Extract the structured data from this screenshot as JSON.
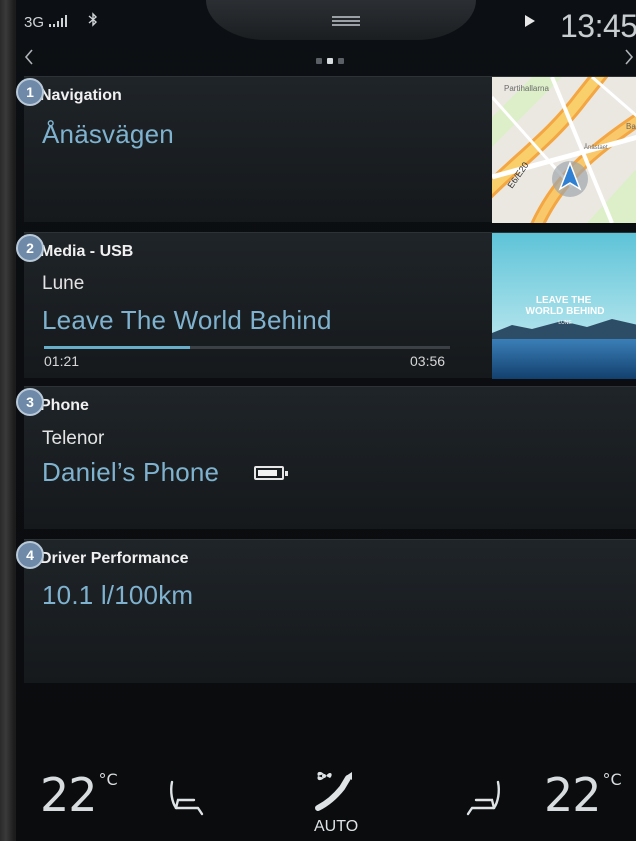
{
  "status_bar": {
    "network": "3G",
    "signal_icon": "signal-bars-icon",
    "bluetooth_icon": "bluetooth-icon",
    "play_icon": "play-icon",
    "clock": "13:45"
  },
  "pager": {
    "pages": 3,
    "active_index": 1
  },
  "badges": [
    "1",
    "2",
    "3",
    "4"
  ],
  "tiles": {
    "navigation": {
      "title": "Navigation",
      "destination": "Ånäsvägen",
      "map_labels": [
        "Partihallarna",
        "Ånästaet",
        "E6/E20",
        "Ba"
      ]
    },
    "media": {
      "title": "Media - USB",
      "artist": "Lune",
      "track": "Leave The World Behind",
      "elapsed": "01:21",
      "duration": "03:56",
      "progress_fraction": 0.36,
      "album_text": "LEAVE THE WORLD BEHIND",
      "album_sub": "LUNE"
    },
    "phone": {
      "title": "Phone",
      "carrier": "Telenor",
      "device": "Daniel’s Phone",
      "battery_level": 0.85
    },
    "driver_performance": {
      "title": "Driver Performance",
      "value": "10.1 l/100km"
    }
  },
  "climate": {
    "left_temp": "22",
    "right_temp": "22",
    "unit": "°C",
    "mode": "AUTO"
  },
  "colors": {
    "accent_text": "#7fb2cf",
    "progress": "#66aeca",
    "badge": "#6e8aa8"
  }
}
